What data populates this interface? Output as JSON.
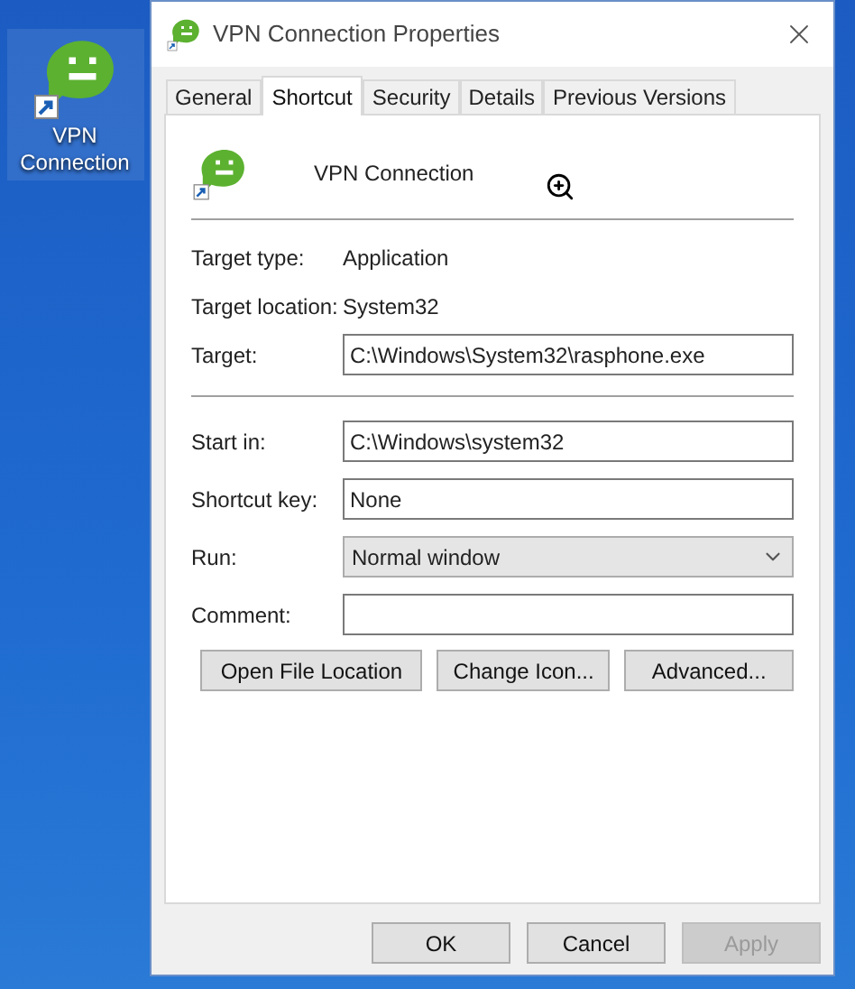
{
  "desktop_icon": {
    "label": "VPN Connection"
  },
  "window": {
    "title": "VPN Connection Properties"
  },
  "tabs": [
    {
      "label": "General",
      "selected": false
    },
    {
      "label": "Shortcut",
      "selected": true
    },
    {
      "label": "Security",
      "selected": false
    },
    {
      "label": "Details",
      "selected": false
    },
    {
      "label": "Previous Versions",
      "selected": false
    }
  ],
  "header": {
    "name": "VPN Connection"
  },
  "info": [
    {
      "label": "Target type:",
      "value": "Application"
    },
    {
      "label": "Target location:",
      "value": "System32"
    }
  ],
  "target": {
    "label": "Target:",
    "value": "C:\\Windows\\System32\\rasphone.exe"
  },
  "fields": [
    {
      "kind": "text",
      "label": "Start in:",
      "value": "C:\\Windows\\system32"
    },
    {
      "kind": "text",
      "label": "Shortcut key:",
      "value": "None"
    },
    {
      "kind": "select",
      "label": "Run:",
      "value": "Normal window"
    },
    {
      "kind": "text",
      "label": "Comment:"
    }
  ],
  "action_buttons": [
    {
      "label": "Open File Location"
    },
    {
      "label": "Change Icon..."
    },
    {
      "label": "Advanced..."
    }
  ],
  "dialog_buttons": [
    {
      "label": "OK",
      "disabled": false
    },
    {
      "label": "Cancel",
      "disabled": false
    },
    {
      "label": "Apply",
      "disabled": true
    }
  ]
}
